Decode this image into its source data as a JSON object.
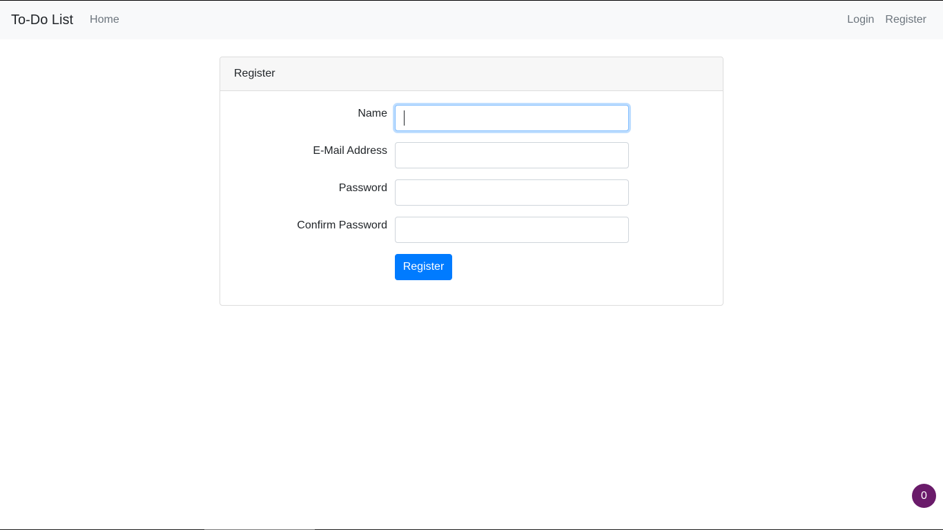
{
  "navbar": {
    "brand": "To-Do List",
    "home_label": "Home",
    "login_label": "Login",
    "register_label": "Register",
    "background": "#f8f9fa"
  },
  "card": {
    "header": "Register",
    "fields": [
      {
        "label": "Name",
        "value": "",
        "focused": true
      },
      {
        "label": "E-Mail Address",
        "value": ""
      },
      {
        "label": "Password",
        "value": ""
      },
      {
        "label": "Confirm Password",
        "value": ""
      }
    ],
    "submit_label": "Register",
    "accent_color": "#007bff"
  },
  "floating_badge": {
    "count": "0",
    "color": "#6a1b6a"
  }
}
